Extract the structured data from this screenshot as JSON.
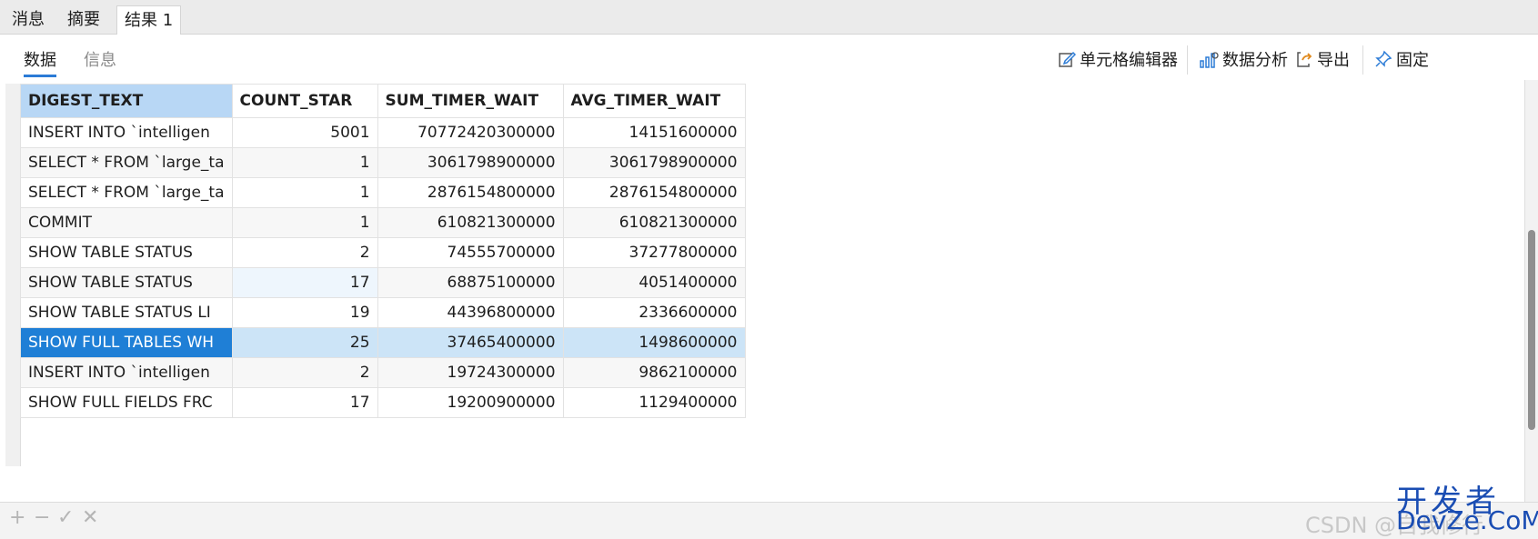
{
  "top_tabs": [
    "消息",
    "摘要",
    "结果 1"
  ],
  "sub_tabs": [
    "数据",
    "信息"
  ],
  "toolbar": {
    "cell_editor": "单元格编辑器",
    "data_analysis": "数据分析",
    "export": "导出",
    "pin": "固定"
  },
  "table": {
    "columns": [
      "DIGEST_TEXT",
      "COUNT_STAR",
      "SUM_TIMER_WAIT",
      "AVG_TIMER_WAIT"
    ],
    "rows": [
      [
        "INSERT INTO `intelligen",
        "5001",
        "70772420300000",
        "14151600000"
      ],
      [
        "SELECT * FROM `large_ta",
        "1",
        "3061798900000",
        "3061798900000"
      ],
      [
        "SELECT * FROM `large_ta",
        "1",
        "2876154800000",
        "2876154800000"
      ],
      [
        "COMMIT",
        "1",
        "610821300000",
        "610821300000"
      ],
      [
        "SHOW TABLE STATUS",
        "2",
        "74555700000",
        "37277800000"
      ],
      [
        "SHOW TABLE STATUS",
        "17",
        "68875100000",
        "4051400000"
      ],
      [
        "SHOW TABLE STATUS LI",
        "19",
        "44396800000",
        "2336600000"
      ],
      [
        "SHOW FULL TABLES WH",
        "25",
        "37465400000",
        "1498600000"
      ],
      [
        "INSERT INTO `intelligen",
        "2",
        "19724300000",
        "9862100000"
      ],
      [
        "SHOW FULL FIELDS FRC",
        "17",
        "19200900000",
        "1129400000"
      ]
    ]
  },
  "bottom": {
    "add": "+",
    "remove": "−",
    "apply": "✓",
    "cancel": "✕"
  },
  "watermark": {
    "csdn": "CSDN @自我修行",
    "cn": "开发者",
    "en": "DevZe.CoM"
  }
}
